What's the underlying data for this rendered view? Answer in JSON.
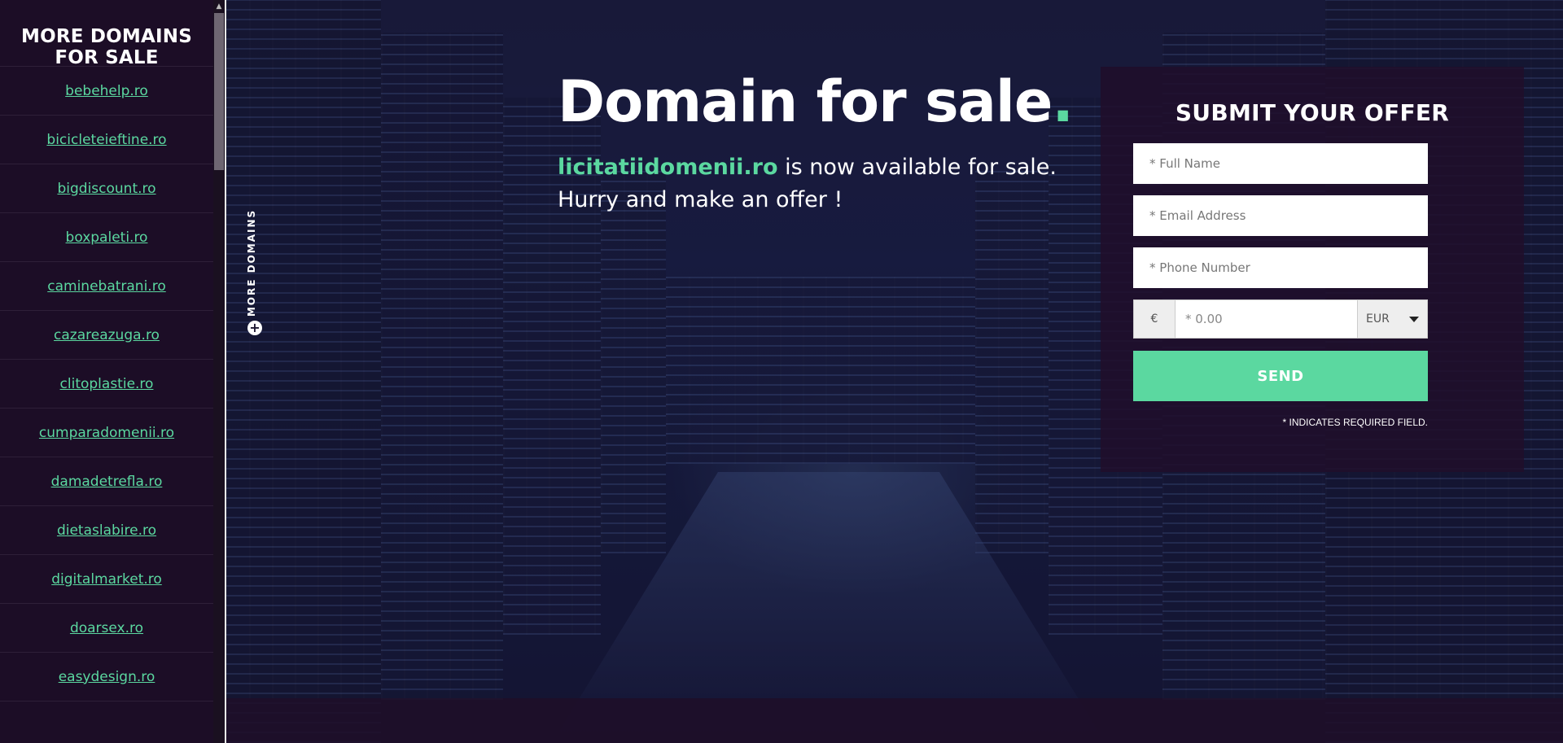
{
  "sidebar": {
    "title": "MORE DOMAINS FOR SALE",
    "domains": [
      "bebehelp.ro",
      "bicicleteieftine.ro",
      "bigdiscount.ro",
      "boxpaleti.ro",
      "caminebatrani.ro",
      "cazareazuga.ro",
      "clitoplastie.ro",
      "cumparadomenii.ro",
      "damadetrefla.ro",
      "dietaslabire.ro",
      "digitalmarket.ro",
      "doarsex.ro",
      "easydesign.ro"
    ]
  },
  "more_tab": {
    "label": "MORE DOMAINS",
    "icon": "plus-circle-icon"
  },
  "hero": {
    "headline": "Domain for sale",
    "headline_dot": ".",
    "domain": "licitatiidomenii.ro",
    "subline_rest": " is now available for sale.",
    "subline_line2": "Hurry and make an offer !"
  },
  "offer_form": {
    "title": "SUBMIT YOUR OFFER",
    "full_name_placeholder": "* Full Name",
    "email_placeholder": "* Email Address",
    "phone_placeholder": "* Phone Number",
    "currency_symbol": "€",
    "price_placeholder": "* 0.00",
    "currency_selected": "EUR",
    "send_label": "SEND",
    "required_note": "* INDICATES REQUIRED FIELD."
  },
  "colors": {
    "accent": "#5bd8a0",
    "sidebar_bg": "#1c0d26",
    "panel_bg": "#200e2a"
  }
}
